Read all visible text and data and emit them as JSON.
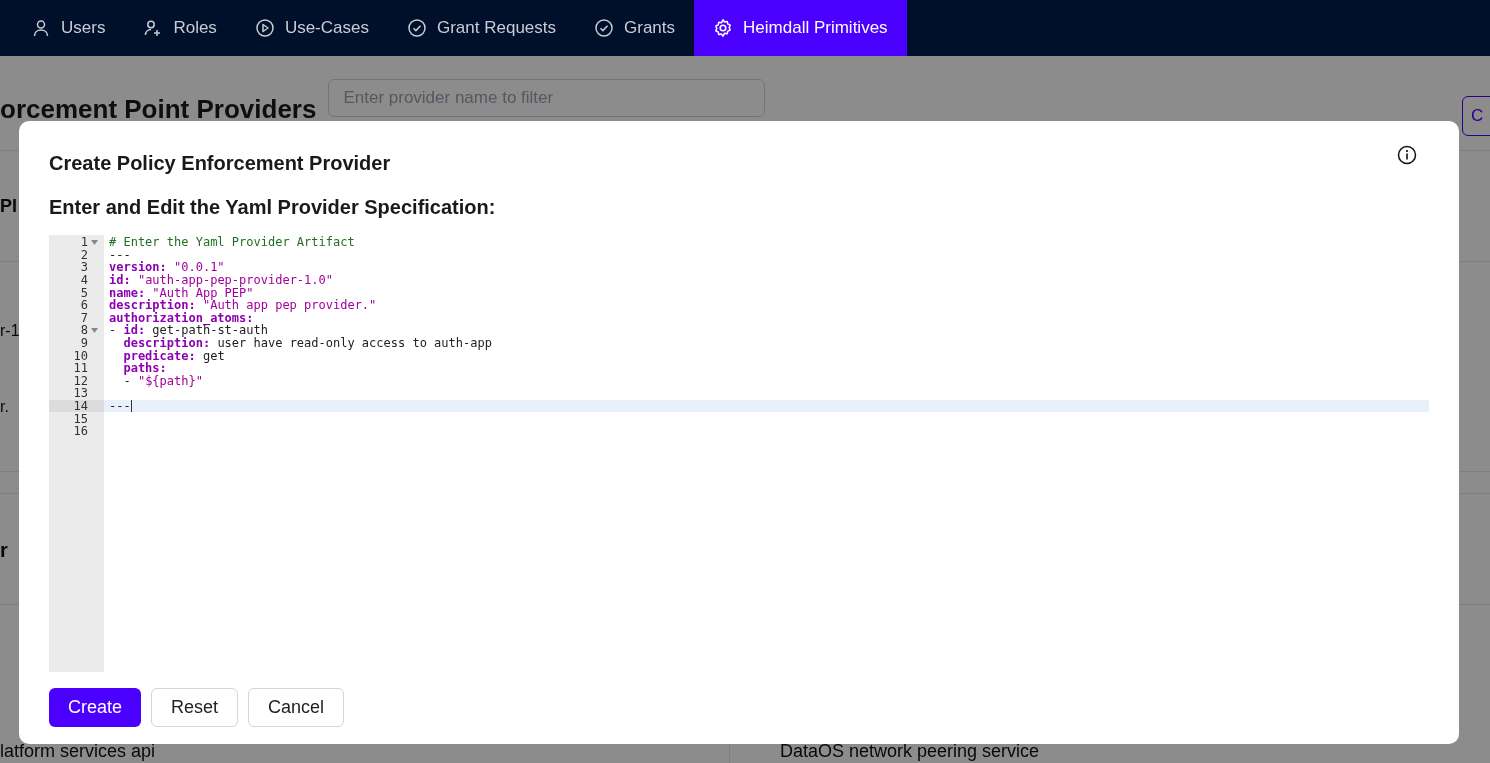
{
  "nav": {
    "tabs": [
      {
        "label": "Users",
        "selected": false
      },
      {
        "label": "Roles",
        "selected": false
      },
      {
        "label": "Use-Cases",
        "selected": false
      },
      {
        "label": "Grant Requests",
        "selected": false
      },
      {
        "label": "Grants",
        "selected": false
      },
      {
        "label": "Heimdall Primitives",
        "selected": true
      }
    ]
  },
  "background": {
    "heading": "orcement Point Providers",
    "filter": {
      "placeholder": "Enter provider name to filter"
    },
    "button": "C",
    "fragments": [
      {
        "text": "PI",
        "bold": true
      },
      {
        "text": "r-1",
        "bold": false
      },
      {
        "text": "r.",
        "bold": false
      },
      {
        "text": "r",
        "bold": true
      }
    ],
    "card_titles": [
      "latform services api",
      "DataOS network peering service"
    ]
  },
  "dialog": {
    "title": "Create Policy Enforcement Provider",
    "subtitle": "Enter and Edit the Yaml Provider Specification:",
    "editor": {
      "lines": [
        {
          "number": "1",
          "fold": true,
          "active": false,
          "tokens": [
            {
              "kind": "comment",
              "text": "# Enter the Yaml Provider Artifact"
            }
          ]
        },
        {
          "number": "2",
          "fold": false,
          "active": false,
          "tokens": [
            {
              "kind": "plain",
              "text": "---"
            }
          ]
        },
        {
          "number": "3",
          "fold": false,
          "active": false,
          "tokens": [
            {
              "kind": "key",
              "text": "version:"
            },
            {
              "kind": "string",
              "text": " \"0.0.1\""
            }
          ]
        },
        {
          "number": "4",
          "fold": false,
          "active": false,
          "tokens": [
            {
              "kind": "key",
              "text": "id:"
            },
            {
              "kind": "string",
              "text": " \"auth-app-pep-provider-1.0\""
            }
          ]
        },
        {
          "number": "5",
          "fold": false,
          "active": false,
          "tokens": [
            {
              "kind": "key",
              "text": "name:"
            },
            {
              "kind": "string",
              "text": " \"Auth App PEP\""
            }
          ]
        },
        {
          "number": "6",
          "fold": false,
          "active": false,
          "tokens": [
            {
              "kind": "key",
              "text": "description:"
            },
            {
              "kind": "string",
              "text": " \"Auth app pep provider.\""
            }
          ]
        },
        {
          "number": "7",
          "fold": false,
          "active": false,
          "tokens": [
            {
              "kind": "key",
              "text": "authorization_atoms:"
            }
          ]
        },
        {
          "number": "8",
          "fold": true,
          "active": false,
          "tokens": [
            {
              "kind": "plain",
              "text": "- "
            },
            {
              "kind": "key",
              "text": "id:"
            },
            {
              "kind": "plain",
              "text": " get-path-st-auth"
            }
          ]
        },
        {
          "number": "9",
          "fold": false,
          "active": false,
          "tokens": [
            {
              "kind": "key",
              "text": "  description:"
            },
            {
              "kind": "plain",
              "text": " user have read-only access to auth-app"
            }
          ]
        },
        {
          "number": "10",
          "fold": false,
          "active": false,
          "tokens": [
            {
              "kind": "key",
              "text": "  predicate:"
            },
            {
              "kind": "plain",
              "text": " get"
            }
          ]
        },
        {
          "number": "11",
          "fold": false,
          "active": false,
          "tokens": [
            {
              "kind": "key",
              "text": "  paths:"
            }
          ]
        },
        {
          "number": "12",
          "fold": false,
          "active": false,
          "tokens": [
            {
              "kind": "plain",
              "text": "  - "
            },
            {
              "kind": "string",
              "text": "\"${path}\""
            }
          ]
        },
        {
          "number": "13",
          "fold": false,
          "active": false
        },
        {
          "number": "14",
          "fold": false,
          "active": true,
          "tokens": [
            {
              "kind": "plain",
              "text": "---"
            }
          ]
        },
        {
          "number": "15",
          "fold": false,
          "active": false
        },
        {
          "number": "16",
          "fold": false,
          "active": false
        }
      ]
    },
    "buttons": [
      {
        "label": "Create",
        "kind": "primary"
      },
      {
        "label": "Reset",
        "kind": "secondary"
      },
      {
        "label": "Cancel",
        "kind": "secondary"
      }
    ]
  }
}
